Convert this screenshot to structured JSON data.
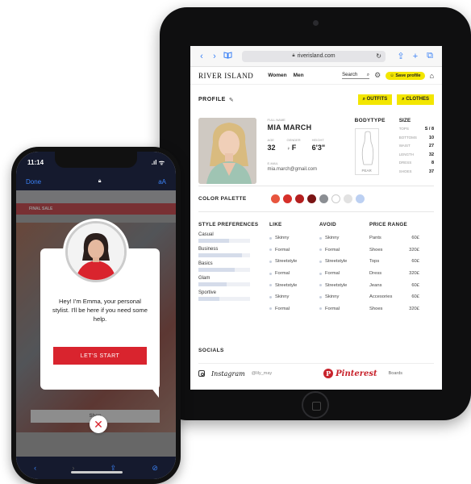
{
  "tablet": {
    "safari": {
      "back": "‹",
      "forward": "›",
      "bookmarks": "📖",
      "url": "riverisland.com",
      "reload": "↻",
      "share": "⇪",
      "new_tab": "+",
      "tabs": "⧉"
    },
    "site": {
      "brand": "RIVER ISLAND",
      "nav": [
        "Women",
        "Men"
      ],
      "search_label": "Search",
      "save_profile": "Save profile"
    },
    "profile": {
      "title": "PROFILE",
      "outfits_btn": "OUTFITS",
      "clothes_btn": "CLOTHES",
      "full_name_label": "FULL NAME",
      "name": "MIA MARCH",
      "age_label": "AGE",
      "age": "32",
      "gender_label": "GENDER",
      "gender": "F",
      "height_label": "HEIGHT",
      "height": "6'3\"",
      "email_label": "E-MAIL",
      "email": "mia.march@gmail.com",
      "bodytype_title": "BODYTYPE",
      "bodytype_caption": "PEAR",
      "size_title": "SIZE",
      "sizes": [
        {
          "label": "TOPS",
          "value": "S / 8"
        },
        {
          "label": "BOTTOMS",
          "value": "10"
        },
        {
          "label": "WAIST",
          "value": "27"
        },
        {
          "label": "LENGTH",
          "value": "32"
        },
        {
          "label": "DRESS",
          "value": "8"
        },
        {
          "label": "SHOES",
          "value": "37"
        }
      ]
    },
    "palette": {
      "title": "COLOR PALETTE",
      "colors": [
        "#e8553e",
        "#d6302a",
        "#b41f1f",
        "#7a1414",
        "#8b8e93",
        "#ffffff",
        "#e2e2e2",
        "#bcd0f2"
      ]
    },
    "prefs": {
      "style_title": "STYLE PREFERENCES",
      "styles": [
        {
          "label": "Casual",
          "level": 0.6
        },
        {
          "label": "Business",
          "level": 0.85
        },
        {
          "label": "Basics",
          "level": 0.7
        },
        {
          "label": "Glam",
          "level": 0.55
        },
        {
          "label": "Sportive",
          "level": 0.4
        }
      ],
      "like_title": "LIKE",
      "like": [
        "Skinny",
        "Formal",
        "Streetstyle",
        "Formal",
        "Streetstyle",
        "Skinny",
        "Formal"
      ],
      "avoid_title": "AVOID",
      "avoid": [
        "Skinny",
        "Formal",
        "Streetstyle",
        "Formal",
        "Streetstyle",
        "Skinny",
        "Formal"
      ],
      "price_title": "PRICE RANGE",
      "prices": [
        {
          "item": "Pants",
          "value": "60£"
        },
        {
          "item": "Shoes",
          "value": "320£"
        },
        {
          "item": "Tops",
          "value": "60£"
        },
        {
          "item": "Dress",
          "value": "320£"
        },
        {
          "item": "Jeans",
          "value": "60£"
        },
        {
          "item": "Accesories",
          "value": "60£"
        },
        {
          "item": "Shoes",
          "value": "320£"
        }
      ]
    },
    "socials": {
      "title": "SOCIALS",
      "instagram": "Instagram",
      "handle": "@lily_may",
      "pinterest": "Pinterest",
      "boards": "Boards"
    }
  },
  "phone": {
    "time": "11:14",
    "signal": ".ıl ᯤ",
    "done": "Done",
    "aa": "aA",
    "banner": "FINAL SALE",
    "shop": "Shop",
    "message": "Hey! I'm Emma, your personal stylist. I'll be here if you need some help.",
    "start_btn": "LET'S START",
    "close": "✕"
  }
}
